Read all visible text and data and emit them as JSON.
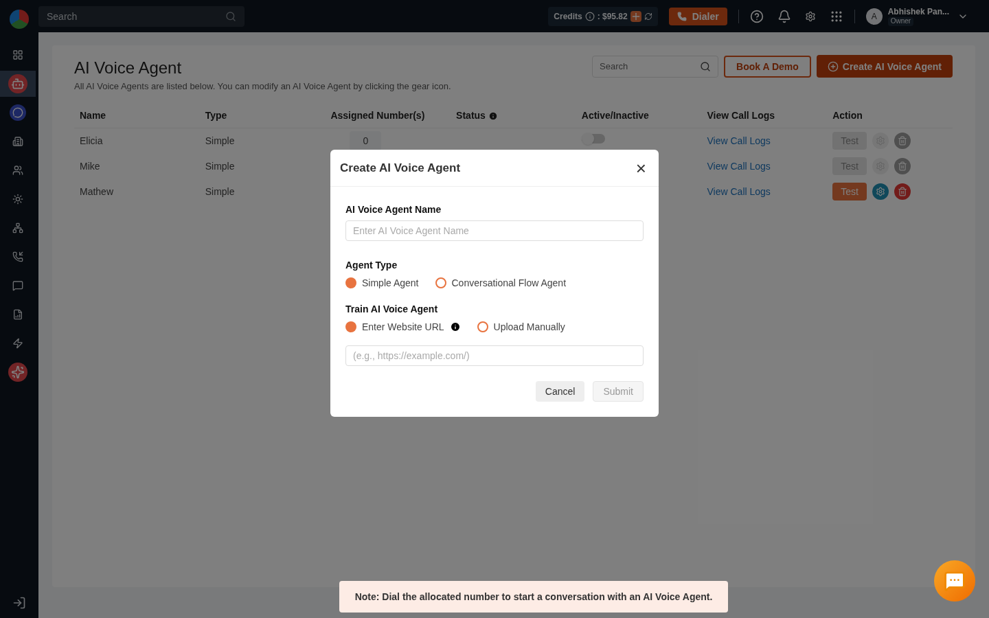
{
  "topbar": {
    "search_placeholder": "Search",
    "credits_label": "Credits",
    "credits_amount": ": $95.82",
    "dialer": "Dialer",
    "user_initial": "A",
    "user_name": "Abhishek Pan...",
    "user_role": "Owner"
  },
  "sidebar": {
    "items": [
      {
        "selected": false
      },
      {
        "selected": true
      },
      {
        "selected": false
      },
      {
        "selected": false
      },
      {
        "selected": false
      },
      {
        "selected": false
      },
      {
        "selected": false
      },
      {
        "selected": false
      },
      {
        "selected": false
      },
      {
        "selected": false
      },
      {
        "selected": false
      },
      {
        "selected": false
      }
    ]
  },
  "page": {
    "title": "AI Voice Agent",
    "subtitle": "All AI Voice Agents are listed below. You can modify an AI Voice Agent by clicking the gear icon.",
    "search_placeholder": "Search",
    "book_demo": "Book A Demo",
    "create_button": "Create AI Voice Agent"
  },
  "table": {
    "columns": [
      "Name",
      "Type",
      "Assigned Number(s)",
      "Status",
      "Active/Inactive",
      "View Call Logs",
      "Action"
    ],
    "rows": [
      {
        "name": "Elicia",
        "type": "Simple",
        "assigned": "0",
        "active": false,
        "logs": "View Call Logs",
        "test": "Test",
        "disabled": true
      },
      {
        "name": "Mike",
        "type": "Simple",
        "logs": "View Call Logs",
        "test": "Test",
        "disabled": true
      },
      {
        "name": "Mathew",
        "type": "Simple",
        "logs": "View Call Logs",
        "test": "Test",
        "disabled": false
      }
    ]
  },
  "modal": {
    "title": "Create AI Voice Agent",
    "close": "×",
    "name_label": "AI Voice Agent Name",
    "name_placeholder": "Enter AI Voice Agent Name",
    "type_label": "Agent Type",
    "type_options": [
      {
        "label": "Simple Agent",
        "selected": true
      },
      {
        "label": "Conversational Flow Agent",
        "selected": false
      }
    ],
    "train_label": "Train AI Voice Agent",
    "train_options": [
      {
        "label": "Enter Website URL",
        "selected": true,
        "info": true
      },
      {
        "label": "Upload Manually",
        "selected": false,
        "info": false
      }
    ],
    "url_placeholder": "(e.g., https://example.com/)",
    "cancel": "Cancel",
    "submit": "Submit",
    "submit_disabled": true
  },
  "note": "**Note:** Dial the allocated number to start a conversation with an AI Voice Agent."
}
